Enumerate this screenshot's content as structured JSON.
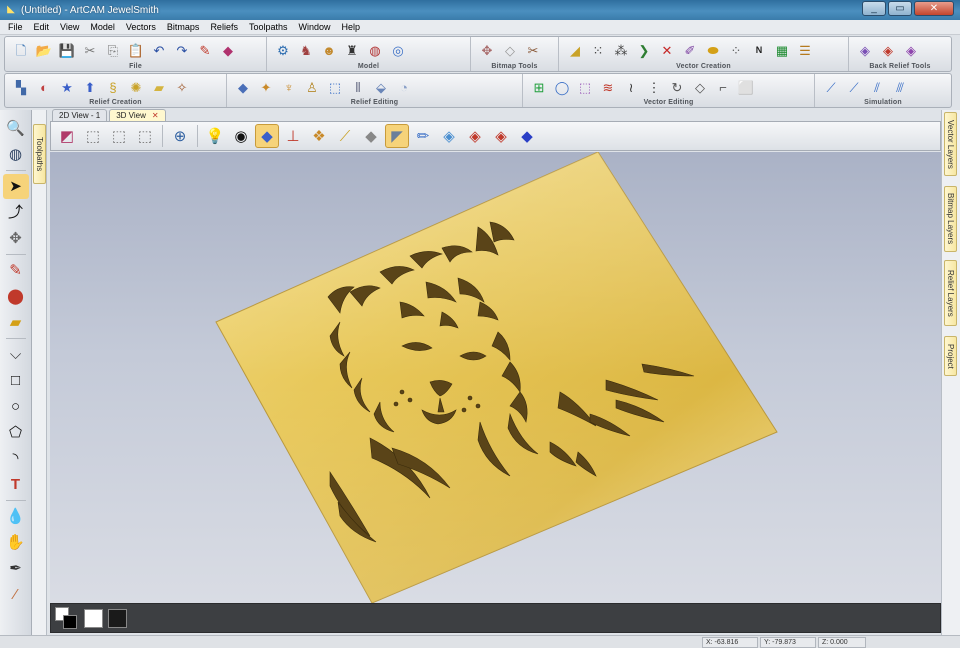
{
  "window": {
    "title": "(Untitled) - ArtCAM JewelSmith",
    "controls": [
      "minimize",
      "maximize",
      "close"
    ]
  },
  "menu": [
    "File",
    "Edit",
    "View",
    "Model",
    "Vectors",
    "Bitmaps",
    "Reliefs",
    "Toolpaths",
    "Window",
    "Help"
  ],
  "toolbars": {
    "row1": [
      {
        "label": "File",
        "icons": [
          "new-file-icon",
          "open-folder-icon",
          "save-icon",
          "cut-icon",
          "copy-icon",
          "paste-icon",
          "undo-icon",
          "redo-icon",
          "pencil-edit-icon",
          "eraser-icon"
        ]
      },
      {
        "label": "Model",
        "icons": [
          "model-setup-icon",
          "bear-model-icon",
          "dog-face-icon",
          "cowboy-boot-icon",
          "globe-mesh-icon",
          "eye-model-icon"
        ]
      },
      {
        "label": "Bitmap Tools",
        "icons": [
          "bitmap-select-icon",
          "bitmap-paint-icon",
          "bitmap-trace-icon"
        ]
      },
      {
        "label": "Vector Creation",
        "icons": [
          "vector-create-icon",
          "node-grid-icon",
          "node-chain-icon",
          "arrow-node-icon",
          "cross-node-icon",
          "vector-text-icon",
          "star-vector-icon",
          "vector-dots-icon",
          "nesting-icon",
          "grid-chip-icon",
          "layers-icon"
        ]
      },
      {
        "label": "Back Relief Tools",
        "icons": [
          "back-relief-icon",
          "back-relief-red-icon",
          "back-relief-purple-icon"
        ]
      }
    ],
    "row2": [
      {
        "label": "Relief Creation",
        "icons": [
          "relief-shape-icon",
          "relief-wave-icon",
          "star-relief-icon",
          "relief-arrow-icon",
          "spiral-relief-icon",
          "weave-relief-icon",
          "flat-relief-icon",
          "relief-wand-icon"
        ]
      },
      {
        "label": "Relief Editing",
        "icons": [
          "relief-plane-icon",
          "relief-hand-icon",
          "relief-smooth-icon",
          "relief-stamp-icon",
          "relief-copy-icon",
          "relief-move-icon",
          "relief-sculpt-icon",
          "relief-paint-icon"
        ]
      },
      {
        "label": "Vector Editing",
        "icons": [
          "add-vector-icon",
          "ring-vector-icon",
          "dotted-select-icon",
          "wave-vector-icon",
          "zigzag-vector-icon",
          "distribute-icon",
          "rotate-vector-icon",
          "offset-vector-icon",
          "corner-vector-icon",
          "frame-vector-icon"
        ]
      },
      {
        "label": "Simulation",
        "icons": [
          "simulate-icon",
          "simulate-tool-icon",
          "simulate-blue-icon",
          "simulate-end-icon"
        ]
      }
    ]
  },
  "doc_tabs": [
    {
      "label": "2D View - 1",
      "active": false
    },
    {
      "label": "3D View",
      "active": true,
      "closable": true
    }
  ],
  "view_toolbar": [
    "iso-view-icon",
    "top-view-icon",
    "front-view-icon",
    "side-view-icon",
    "zoom-icon",
    "light-bulb-icon",
    "eye-icon",
    "relief-display-icon",
    "axes-icon",
    "texture-icon",
    "wireframe-icon",
    "shaded-icon",
    "gold-material-icon",
    "paint-brush-icon",
    "layer-a-icon",
    "layer-b-icon",
    "layer-c-icon",
    "color-diamond-icon"
  ],
  "left_tools": [
    "zoom-window-icon",
    "globe-navigate-icon",
    "select-arrow-icon",
    "node-edit-icon",
    "transform-icon",
    "red-pencil-icon",
    "paint-icon",
    "fill-icon",
    "draw-vector-icon",
    "rectangle-icon",
    "circle-icon",
    "polygon-icon",
    "arc-icon",
    "text-tool-icon",
    "drop-icon",
    "shape-editor-icon",
    "sculpt-icon",
    "pipette-icon"
  ],
  "side_tabs": {
    "left": [
      "Toolpaths"
    ],
    "right": [
      "Vector Layers",
      "Bitmap Layers",
      "Relief Layers",
      "Project"
    ]
  },
  "viewport": {
    "mode": "3D",
    "material": "gold",
    "model": "tiger-face-relief"
  },
  "palette": {
    "primary": "#ffffff",
    "secondary": "#000000",
    "swatches": [
      "#ffffff",
      "#1a1a1a"
    ]
  },
  "status": {
    "x": "X: -63.816",
    "y": "Y: -79.873",
    "z": "Z: 0.000"
  },
  "colors": {
    "title_bar": "#3a7cab",
    "gold_relief": "#e6c65a",
    "viewport_bg": "#bfc6d4",
    "active_tab": "#fff8cf"
  }
}
